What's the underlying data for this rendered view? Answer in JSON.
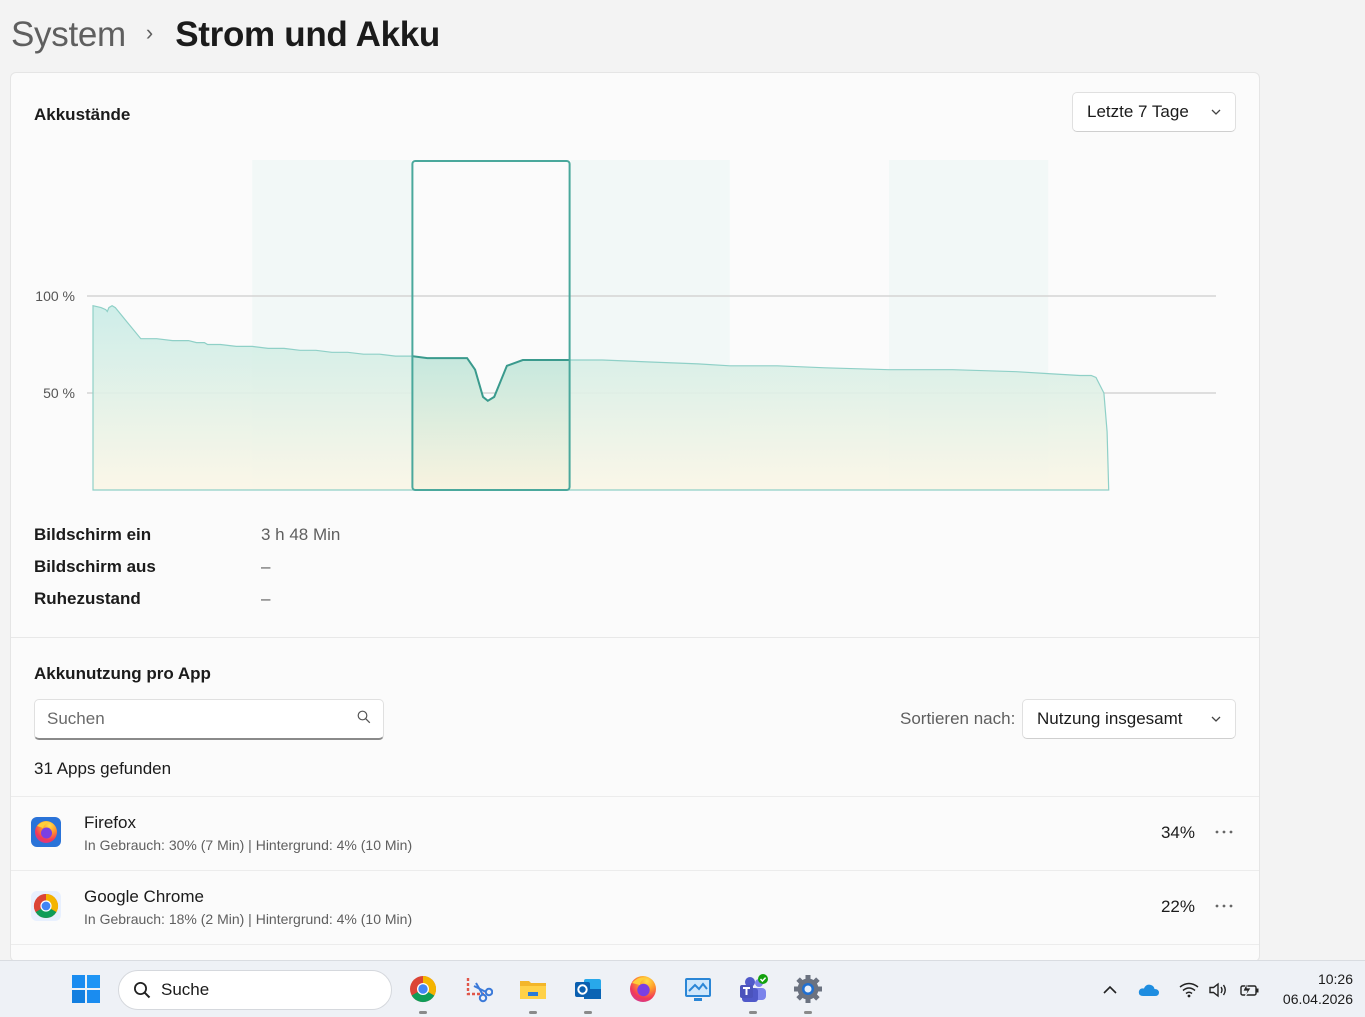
{
  "breadcrumb": {
    "parent": "System",
    "separator": "›",
    "current": "Strom und Akku"
  },
  "battery_levels": {
    "title": "Akkustände",
    "range_dropdown": "Letzte 7 Tage",
    "y_tick_labels": [
      "100 %",
      "50 %"
    ]
  },
  "chart_data": {
    "type": "area",
    "title": "Akkustände",
    "ylim": [
      0,
      100
    ],
    "y_ticks": [
      50,
      100
    ],
    "y_tick_labels": [
      "100 %",
      "50 %"
    ],
    "grid": true,
    "selected_column": 3,
    "columns": 7,
    "series": [
      {
        "x": [
          0,
          0.05,
          0.08,
          0.09,
          0.1,
          0.12,
          0.14,
          0.16,
          0.2,
          0.3,
          0.4,
          0.5,
          0.6,
          0.65,
          0.7,
          0.72,
          0.8,
          0.9,
          1.0,
          1.1,
          1.2,
          1.3,
          1.4,
          1.5,
          1.6,
          1.7,
          1.8,
          1.9,
          2.0,
          2.1,
          2.2,
          2.35,
          2.4,
          2.45,
          2.48,
          2.52,
          2.6,
          2.7,
          2.8,
          2.9,
          3.0,
          3.2,
          3.5,
          3.8,
          4.0,
          4.3,
          4.6,
          5.0,
          5.4,
          5.8,
          6.0,
          6.2,
          6.27,
          6.3,
          6.35,
          6.37,
          6.38
        ],
        "values": [
          95,
          94,
          93,
          92,
          94,
          95,
          94,
          92,
          88,
          78,
          78,
          77,
          77,
          76,
          76,
          75,
          75,
          74,
          74,
          73,
          73,
          72,
          72,
          71,
          71,
          70,
          70,
          69,
          69,
          68,
          68,
          68,
          62,
          48,
          46,
          48,
          64,
          67,
          67,
          67,
          67,
          67,
          66,
          65,
          64,
          64,
          63,
          62,
          62,
          61,
          60,
          59,
          59,
          58,
          50,
          30,
          0
        ]
      }
    ]
  },
  "stats": [
    {
      "label": "Bildschirm ein",
      "value": "3 h 48 Min"
    },
    {
      "label": "Bildschirm aus",
      "value": "–"
    },
    {
      "label": "Ruhezustand",
      "value": "–"
    }
  ],
  "app_usage": {
    "title": "Akkunutzung pro App",
    "search_placeholder": "Suchen",
    "sort_label": "Sortieren nach:",
    "sort_value": "Nutzung insgesamt",
    "apps_found": "31 Apps gefunden",
    "apps": [
      {
        "name": "Firefox",
        "detail": "In Gebrauch: 30% (7 Min) | Hintergrund: 4% (10 Min)",
        "percent": "34%",
        "icon": "firefox-icon"
      },
      {
        "name": "Google Chrome",
        "detail": "In Gebrauch: 18% (2 Min) | Hintergrund: 4% (10 Min)",
        "percent": "22%",
        "icon": "chrome-icon"
      }
    ]
  },
  "taskbar": {
    "search_label": "Suche",
    "time": "10:26",
    "date": "06.04.2026",
    "pinned": [
      "chrome-icon",
      "snipping-tool-icon",
      "file-explorer-icon",
      "outlook-icon",
      "firefox-icon",
      "remote-desktop-icon",
      "teams-icon",
      "settings-icon"
    ],
    "tray": [
      "show-hidden-icons-chevron",
      "onedrive-icon",
      "wifi-icon",
      "volume-icon",
      "battery-charging-icon"
    ]
  },
  "colors": {
    "accent": "#4aa89c",
    "chart_fill_top": "#c4ebe6",
    "chart_fill_bottom": "#fbf7ea",
    "card_bg": "#fbfbfb",
    "page_bg": "#f3f3f3"
  }
}
